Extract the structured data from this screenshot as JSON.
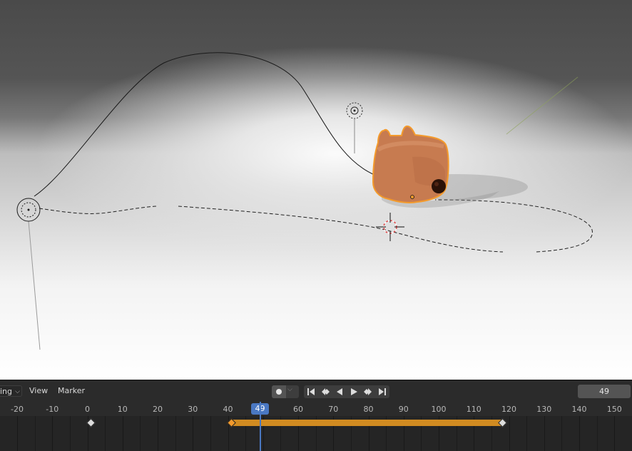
{
  "timeline": {
    "header": {
      "mode_dropdown_label": "ing",
      "view_menu": "View",
      "marker_menu": "Marker",
      "current_frame_field": "49"
    },
    "ruler": {
      "ticks": [
        "-20",
        "-10",
        "0",
        "10",
        "20",
        "30",
        "40",
        "60",
        "70",
        "80",
        "90",
        "100",
        "110",
        "120",
        "130",
        "140",
        "150"
      ],
      "current_frame": "49"
    },
    "keyframe_range": {
      "start": 41,
      "end": 118
    },
    "keyframes": [
      1,
      41,
      118
    ]
  },
  "colors": {
    "accent": "#4a78c2",
    "selection_orange": "#f39a2c",
    "keyframe_bar": "#d18b21",
    "object_body": "#c97a4f"
  },
  "icons": {
    "record": "record-dot-icon",
    "jump_start": "jump-to-start-icon",
    "prev_keyframe": "prev-keyframe-icon",
    "play_reverse": "play-reverse-icon",
    "play": "play-icon",
    "next_keyframe": "next-keyframe-icon",
    "jump_end": "jump-to-end-icon"
  }
}
